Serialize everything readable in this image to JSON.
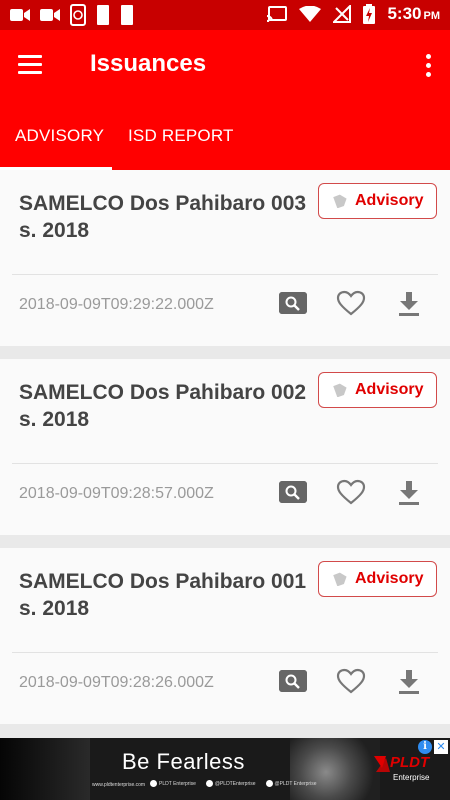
{
  "status_bar": {
    "time": "5:30",
    "ampm": "PM",
    "left_icons": [
      "video-icon",
      "video-icon",
      "phone-sync-icon",
      "sim-icon",
      "sim-icon"
    ],
    "right_icons": [
      "cast-icon",
      "wifi-icon",
      "no-signal-icon",
      "battery-charging-icon"
    ]
  },
  "app_bar": {
    "title": "Issuances",
    "menu_icon": "menu-icon",
    "more_icon": "more-vert-icon",
    "background": "#ff0000"
  },
  "tabs": [
    {
      "label": "ADVISORY",
      "selected": true
    },
    {
      "label": "ISD REPORT",
      "selected": false
    }
  ],
  "items": [
    {
      "title": "SAMELCO Dos Pahibaro 003 s. 2018",
      "badge": "Advisory",
      "timestamp": "2018-09-09T09:29:22.000Z"
    },
    {
      "title": "SAMELCO Dos Pahibaro 002 s. 2018",
      "badge": "Advisory",
      "timestamp": "2018-09-09T09:28:57.000Z"
    },
    {
      "title": "SAMELCO Dos Pahibaro 001 s. 2018",
      "badge": "Advisory",
      "timestamp": "2018-09-09T09:28:26.000Z"
    }
  ],
  "ad": {
    "headline": "Be Fearless",
    "url": "www.pldtenterprise.com",
    "social": [
      "PLDT Enterprise",
      "@PLDTEnterprise",
      "@PLDT Enterprise"
    ],
    "logo": "PLDT",
    "logo_sub": "Enterprise",
    "info": "i",
    "close": "✕"
  }
}
